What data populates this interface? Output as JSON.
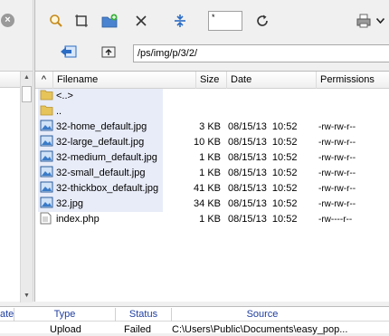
{
  "left_panel": {
    "close_glyph": "×"
  },
  "toolbar": {
    "filter_value": "*"
  },
  "path": {
    "value": "/ps/img/p/3/2/"
  },
  "list": {
    "columns": [
      "Filename",
      "Size",
      "Date",
      "Permissions"
    ],
    "sort_glyph": "^",
    "rows": [
      {
        "icon": "folder-icon",
        "name": "<..>",
        "size": "",
        "date": "",
        "perms": ""
      },
      {
        "icon": "folder-icon",
        "name": "..",
        "size": "",
        "date": "",
        "perms": ""
      },
      {
        "icon": "image-file-icon",
        "name": "32-home_default.jpg",
        "size": "3 KB",
        "date": "08/15/13  10:52",
        "perms": "-rw-rw-r--"
      },
      {
        "icon": "image-file-icon",
        "name": "32-large_default.jpg",
        "size": "10 KB",
        "date": "08/15/13  10:52",
        "perms": "-rw-rw-r--"
      },
      {
        "icon": "image-file-icon",
        "name": "32-medium_default.jpg",
        "size": "1 KB",
        "date": "08/15/13  10:52",
        "perms": "-rw-rw-r--"
      },
      {
        "icon": "image-file-icon",
        "name": "32-small_default.jpg",
        "size": "1 KB",
        "date": "08/15/13  10:52",
        "perms": "-rw-rw-r--"
      },
      {
        "icon": "image-file-icon",
        "name": "32-thickbox_default.jpg",
        "size": "41 KB",
        "date": "08/15/13  10:52",
        "perms": "-rw-rw-r--"
      },
      {
        "icon": "image-file-icon",
        "name": "32.jpg",
        "size": "34 KB",
        "date": "08/15/13  10:52",
        "perms": "-rw-rw-r--"
      },
      {
        "icon": "php-file-icon",
        "name": "index.php",
        "size": "1 KB",
        "date": "08/15/13  10:52",
        "perms": "-rw----r--"
      }
    ]
  },
  "queue": {
    "columns": [
      "ate",
      "Type",
      "Status",
      "Source"
    ],
    "row": {
      "type": "Upload",
      "status": "Failed",
      "source": "C:\\Users\\Public\\Documents\\easy_pop..."
    }
  },
  "colors": {
    "selection": "#e8ecf8",
    "queue_header_text": "#1f3ea0",
    "folder": "#e7c45a",
    "accent_blue": "#2b6cc4"
  }
}
